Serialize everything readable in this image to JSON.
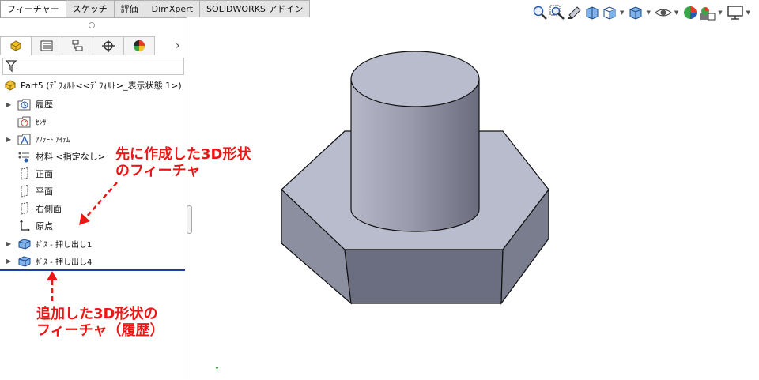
{
  "command_tabs": [
    {
      "label": "フィーチャー",
      "active": true
    },
    {
      "label": "スケッチ",
      "active": false
    },
    {
      "label": "評価",
      "active": false
    },
    {
      "label": "DimXpert",
      "active": false
    },
    {
      "label": "SOLIDWORKS アドイン",
      "active": false
    }
  ],
  "manager_tabs": [
    {
      "icon": "featuremanager-tree-icon"
    },
    {
      "icon": "propertymanager-icon"
    },
    {
      "icon": "configurationmanager-icon"
    },
    {
      "icon": "dimxpertmanager-icon"
    },
    {
      "icon": "displaymanager-icon"
    }
  ],
  "part": {
    "label": "Part5  (ﾃﾞﾌｫﾙﾄ<<ﾃﾞﾌｫﾙﾄ>_表示状態 1>)"
  },
  "tree": [
    {
      "label": "履歴",
      "icon": "history-folder-icon",
      "expandable": true
    },
    {
      "label": "ｾﾝｻｰ",
      "icon": "sensors-folder-icon",
      "expandable": false
    },
    {
      "label": "ｱﾉﾃｰﾄ ｱｲﾃﾑ",
      "icon": "annotations-folder-icon",
      "expandable": true
    },
    {
      "label": "材料 <指定なし>",
      "icon": "material-icon",
      "expandable": false
    },
    {
      "label": "正面",
      "icon": "plane-icon",
      "expandable": false
    },
    {
      "label": "平面",
      "icon": "plane-icon",
      "expandable": false
    },
    {
      "label": "右側面",
      "icon": "plane-icon",
      "expandable": false
    },
    {
      "label": "原点",
      "icon": "origin-icon",
      "expandable": false
    },
    {
      "label": "ﾎﾞｽ - 押し出し1",
      "icon": "boss-extrude-icon",
      "expandable": true
    },
    {
      "label": "ﾎﾞｽ - 押し出し4",
      "icon": "boss-extrude-icon",
      "expandable": true
    }
  ],
  "annotations": {
    "first_line1": "先に作成した3D形状",
    "first_line2": "のフィーチャ",
    "added_line1": "追加した3D形状の",
    "added_line2": "フィーチャ（履歴）"
  },
  "colors": {
    "accent": "#ee1515",
    "rollback_bar": "#1e3fa8",
    "model_top": "#b8bccd",
    "model_side_dark": "#6b6e80",
    "model_side_light": "#8c8fa0"
  },
  "headsup_toolbar": [
    "zoom-to-fit-icon",
    "zoom-to-area-icon",
    "previous-view-icon",
    "section-view-icon",
    "view-orientation-icon",
    "display-style-icon",
    "hide-show-items-icon",
    "edit-appearance-icon",
    "apply-scene-icon",
    "view-settings-icon"
  ],
  "triad_label": "Y"
}
